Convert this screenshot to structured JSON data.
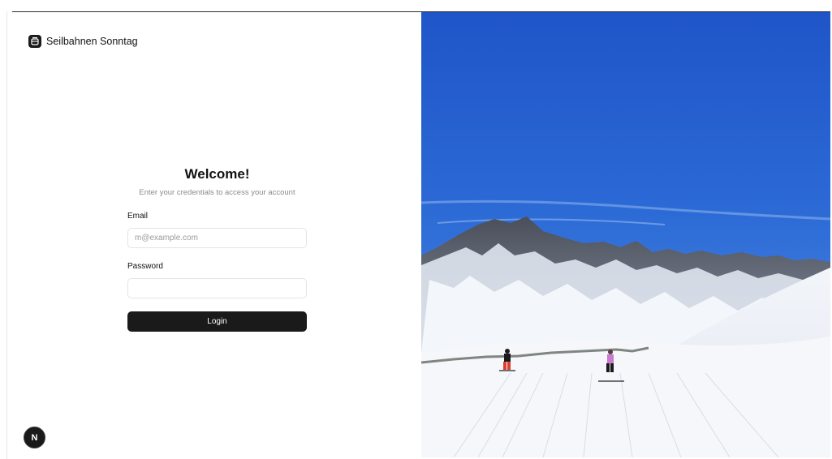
{
  "brand": {
    "name": "Seilbahnen Sonntag",
    "icon": "cable-car-icon"
  },
  "login": {
    "title": "Welcome!",
    "subtitle": "Enter your credentials to access your account",
    "email_label": "Email",
    "email_placeholder": "m@example.com",
    "email_value": "",
    "password_label": "Password",
    "password_value": "",
    "button_label": "Login"
  },
  "dev_badge": {
    "label": "N",
    "icon": "nextjs-icon"
  },
  "colors": {
    "primary": "#1a1a1a",
    "muted_text": "#8a8a8a",
    "border": "#e4e4e7",
    "sky": "#2f6fd0"
  }
}
